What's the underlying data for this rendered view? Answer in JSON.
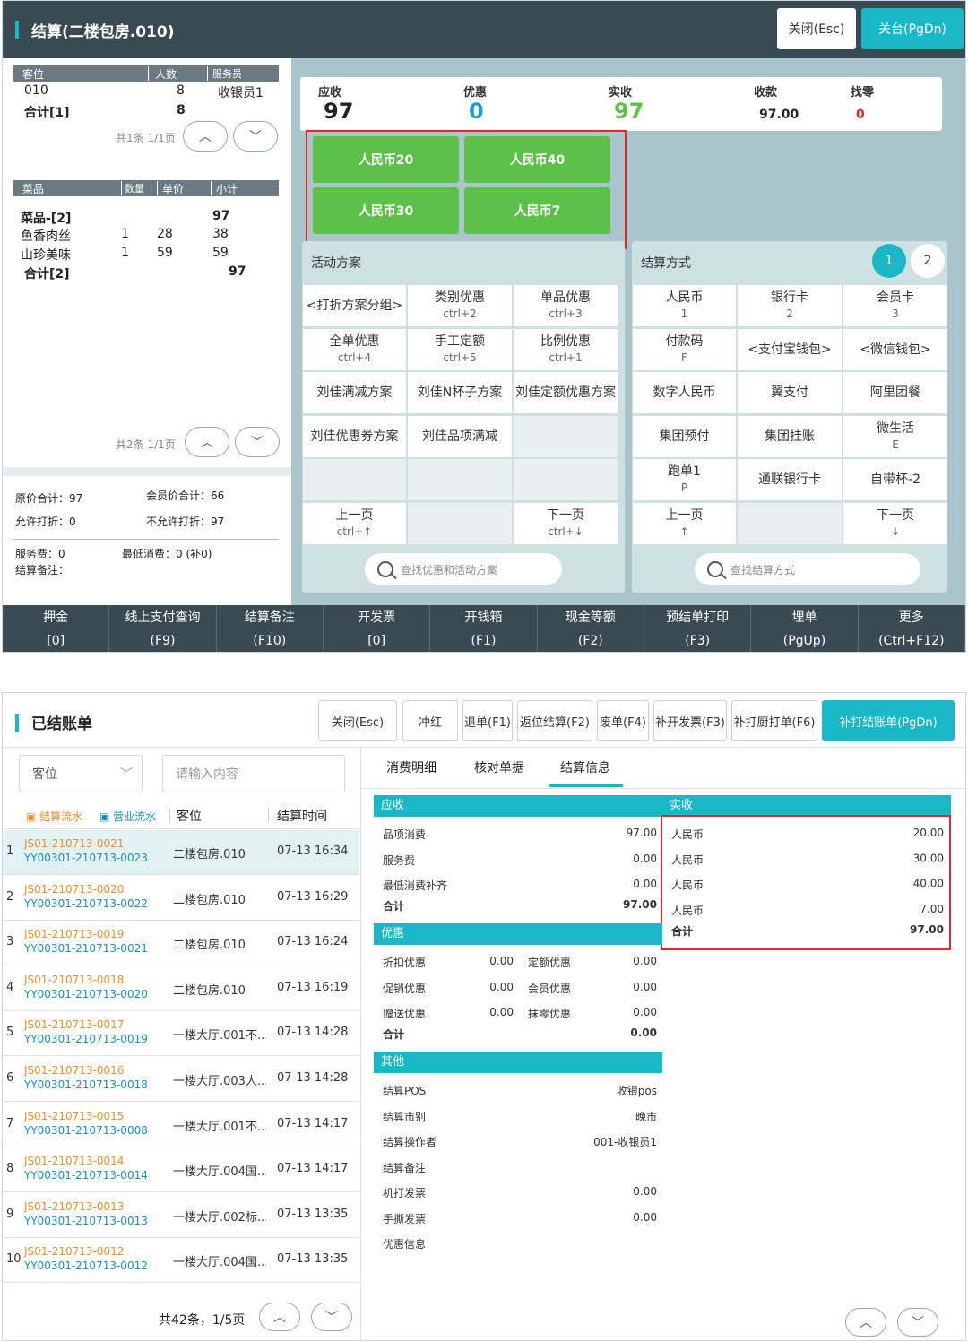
{
  "settle": {
    "title": "结算(二楼包房.010)",
    "close_btn": "关闭(Esc)",
    "checkout_btn": "关台(PgDn)",
    "table_hdr": [
      "客位",
      "人数",
      "服务员"
    ],
    "table_row": [
      "010",
      "8",
      "收银员1"
    ],
    "table_total": [
      "合计[1]",
      "8"
    ],
    "table_pager": "共1条 1/1页",
    "dish_hdr": [
      "菜品",
      "数量",
      "单价",
      "小计"
    ],
    "dish_group": [
      "菜品-[2]",
      "97"
    ],
    "dishes": [
      [
        "鱼香肉丝",
        "1",
        "28",
        "38"
      ],
      [
        "山珍美味",
        "1",
        "59",
        "59"
      ]
    ],
    "dish_total": [
      "合计[2]",
      "97"
    ],
    "dish_pager": "共2条 1/1页",
    "summary": {
      "orig": "原价合计：97",
      "member": "会员价合计：66",
      "allow": "允许打折：0",
      "noallow": "不允许打折：97",
      "service": "服务费：0",
      "minimum": "最低消费：0 (补0)",
      "note": "结算备注："
    },
    "amounts": [
      {
        "label": "应收",
        "value": "97",
        "color": "#222"
      },
      {
        "label": "优惠",
        "value": "0",
        "color": "#1a9fd0"
      },
      {
        "label": "实收",
        "value": "97",
        "color": "#5dc149"
      },
      {
        "label": "收款",
        "value": "97.00",
        "color": "#222"
      },
      {
        "label": "找零",
        "value": "0",
        "color": "#e0282e"
      }
    ],
    "cash_buttons": [
      "人民币20",
      "人民币40",
      "人民币30",
      "人民币7"
    ],
    "promo_title": "活动方案",
    "promo_cells": [
      [
        "<打折方案分组>",
        ""
      ],
      [
        "类别优惠",
        "ctrl+2"
      ],
      [
        "单品优惠",
        "ctrl+3"
      ],
      [
        "全单优惠",
        "ctrl+4"
      ],
      [
        "手工定额",
        "ctrl+5"
      ],
      [
        "比例优惠",
        "ctrl+1"
      ],
      [
        "刘佳满减方案",
        ""
      ],
      [
        "刘佳N杯子方案",
        ""
      ],
      [
        "刘佳定额优惠方案",
        ""
      ],
      [
        "刘佳优惠券方案",
        ""
      ],
      [
        "刘佳品项满减",
        ""
      ],
      [
        "",
        ""
      ],
      [
        "",
        ""
      ],
      [
        "",
        ""
      ],
      [
        "",
        ""
      ],
      [
        "上一页",
        "ctrl+↑"
      ],
      [
        "",
        ""
      ],
      [
        "下一页",
        "ctrl+↓"
      ]
    ],
    "promo_search": "查找优惠和活动方案",
    "pay_title": "结算方式",
    "pay_pages": [
      "1",
      "2"
    ],
    "pay_cells": [
      [
        "人民币",
        "1"
      ],
      [
        "银行卡",
        "2"
      ],
      [
        "会员卡",
        "3"
      ],
      [
        "付款码",
        "F"
      ],
      [
        "<支付宝钱包>",
        ""
      ],
      [
        "<微信钱包>",
        ""
      ],
      [
        "数字人民币",
        ""
      ],
      [
        "翼支付",
        ""
      ],
      [
        "阿里团餐",
        ""
      ],
      [
        "集团预付",
        ""
      ],
      [
        "集团挂账",
        ""
      ],
      [
        "微生活",
        "E"
      ],
      [
        "跑单1",
        "P"
      ],
      [
        "通联银行卡",
        ""
      ],
      [
        "自带杯-2",
        ""
      ],
      [
        "上一页",
        "↑"
      ],
      [
        "",
        ""
      ],
      [
        "下一页",
        "↓"
      ]
    ],
    "pay_search": "查找结算方式",
    "footer": [
      [
        "押金",
        "[0]"
      ],
      [
        "线上支付查询",
        "(F9)"
      ],
      [
        "结算备注",
        "(F10)"
      ],
      [
        "开发票",
        "[0]"
      ],
      [
        "开钱箱",
        "(F1)"
      ],
      [
        "现金等额",
        "(F2)"
      ],
      [
        "预结单打印",
        "(F3)"
      ],
      [
        "埋单",
        "(PgUp)"
      ],
      [
        "更多",
        "(Ctrl+F12)"
      ]
    ]
  },
  "settled": {
    "title": "已结账单",
    "toolbar": [
      "关闭(Esc)",
      "冲红",
      "退单(F1)",
      "返位结算(F2)",
      "废单(F4)",
      "补开发票(F3)",
      "补打厨打单(F6)"
    ],
    "reprint_btn": "补打结账单(PgDn)",
    "filter_select": "客位",
    "filter_placeholder": "请输入内容",
    "legend_a": "结算流水",
    "legend_b": "营业流水",
    "col_seat": "客位",
    "col_time": "结算时间",
    "rows": [
      [
        "1",
        "JS01-210713-0021",
        "YY00301-210713-0023",
        "二楼包房.010",
        "07-13 16:34"
      ],
      [
        "2",
        "JS01-210713-0020",
        "YY00301-210713-0022",
        "二楼包房.010",
        "07-13 16:29"
      ],
      [
        "3",
        "JS01-210713-0019",
        "YY00301-210713-0021",
        "二楼包房.010",
        "07-13 16:24"
      ],
      [
        "4",
        "JS01-210713-0018",
        "YY00301-210713-0020",
        "二楼包房.010",
        "07-13 16:19"
      ],
      [
        "5",
        "JS01-210713-0017",
        "YY00301-210713-0019",
        "一楼大厅.001不...",
        "07-13 14:28"
      ],
      [
        "6",
        "JS01-210713-0016",
        "YY00301-210713-0018",
        "一楼大厅.003人...",
        "07-13 14:28"
      ],
      [
        "7",
        "JS01-210713-0015",
        "YY00301-210713-0008",
        "一楼大厅.001不...",
        "07-13 14:17"
      ],
      [
        "8",
        "JS01-210713-0014",
        "YY00301-210713-0014",
        "一楼大厅.004国...",
        "07-13 14:17"
      ],
      [
        "9",
        "JS01-210713-0013",
        "YY00301-210713-0013",
        "一楼大厅.002标...",
        "07-13 13:35"
      ],
      [
        "10",
        "JS01-210713-0012",
        "YY00301-210713-0012",
        "一楼大厅.004国...",
        "07-13 13:35"
      ]
    ],
    "pager": "共42条，1/5页",
    "tabs": [
      "消费明细",
      "核对单据",
      "结算信息"
    ],
    "receivable_title": "应收",
    "receivable": [
      [
        "品项消费",
        "97.00"
      ],
      [
        "服务费",
        "0.00"
      ],
      [
        "最低消费补齐",
        "0.00"
      ]
    ],
    "receivable_total": [
      "合计",
      "97.00"
    ],
    "actual_title": "实收",
    "actual": [
      [
        "人民币",
        "20.00"
      ],
      [
        "人民币",
        "30.00"
      ],
      [
        "人民币",
        "40.00"
      ],
      [
        "人民币",
        "7.00"
      ]
    ],
    "actual_total": [
      "合计",
      "97.00"
    ],
    "discount_title": "优惠",
    "discount": [
      [
        "折扣优惠",
        "0.00",
        "定额优惠",
        "0.00"
      ],
      [
        "促销优惠",
        "0.00",
        "会员优惠",
        "0.00"
      ],
      [
        "赠送优惠",
        "0.00",
        "抹零优惠",
        "0.00"
      ]
    ],
    "discount_total": [
      "合计",
      "0.00"
    ],
    "other_title": "其他",
    "other": [
      [
        "结算POS",
        "收银pos"
      ],
      [
        "结算市别",
        "晚市"
      ],
      [
        "结算操作者",
        "001-收银员1"
      ],
      [
        "结算备注",
        ""
      ],
      [
        "机打发票",
        "0.00"
      ],
      [
        "手撕发票",
        "0.00"
      ],
      [
        "优惠信息",
        ""
      ]
    ]
  },
  "colors": {
    "accent": "#1ab7c6",
    "header": "#3a4a52",
    "green": "#5dc149",
    "highlight": "#e0282e"
  }
}
